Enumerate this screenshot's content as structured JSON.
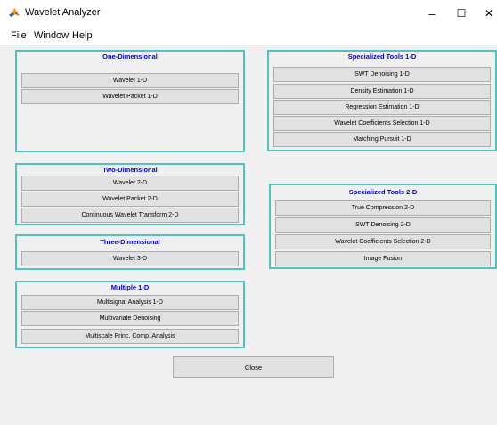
{
  "window": {
    "title": "Wavelet Analyzer",
    "controls": {
      "minimize": "–",
      "maximize": "☐",
      "close": "✕"
    }
  },
  "menu": {
    "items": [
      "File",
      "Window",
      "Help"
    ]
  },
  "colors": {
    "accent_border": "#4fc3bd",
    "panel_title": "#0000e6",
    "button_bg": "#e1e1e1"
  },
  "panels": {
    "one_d": {
      "title": "One-Dimensional",
      "buttons": [
        "Wavelet 1-D",
        "Wavelet Packet 1-D"
      ]
    },
    "two_d": {
      "title": "Two-Dimensional",
      "buttons": [
        "Wavelet 2-D",
        "Wavelet Packet 2-D",
        "Continuous Wavelet Transform 2-D"
      ]
    },
    "three_d": {
      "title": "Three-Dimensional",
      "buttons": [
        "Wavelet 3-D"
      ]
    },
    "multiple_1d": {
      "title": "Multiple 1-D",
      "buttons": [
        "Multisignal Analysis 1-D",
        "Multivariate Denoising",
        "Multiscale Princ. Comp. Analysis"
      ]
    },
    "spec_1d": {
      "title": "Specialized Tools 1-D",
      "buttons": [
        "SWT Denoising 1-D",
        "Density Estimation 1-D",
        "Regression Estimation 1-D",
        "Wavelet Coefficients Selection 1-D",
        "Matching Pursuit 1-D"
      ]
    },
    "spec_2d": {
      "title": "Specialized Tools 2-D",
      "buttons": [
        "True Compression 2-D",
        "SWT Denoising 2-D",
        "Wavelet Coefficients Selection 2-D",
        "Image Fusion"
      ]
    }
  },
  "footer": {
    "close_label": "Close"
  }
}
